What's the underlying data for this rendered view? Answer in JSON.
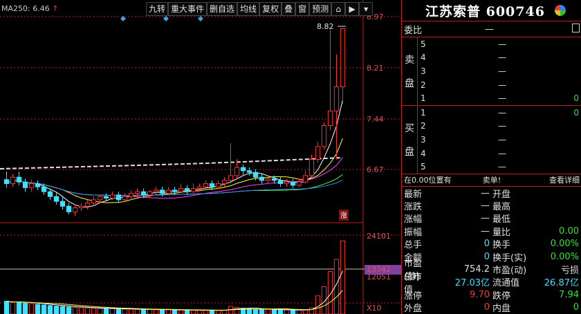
{
  "ma_label": {
    "text": "MA250: 6.46",
    "arrow": "↑"
  },
  "toolbar": [
    "九转",
    "重大事件",
    "删自选",
    "均线",
    "复权",
    "叠",
    "窗",
    "预测"
  ],
  "toolbar_icons": [
    "lock-icon",
    "forward-icon",
    "dropdown-icon"
  ],
  "price_axis": [
    "8.97",
    "8.21",
    "7.44",
    "6.67"
  ],
  "high_label": "8.82",
  "zhang_mark": "涨",
  "volume_axis": [
    "24101",
    "13342",
    "12051",
    "X10"
  ],
  "stock_title": "江苏索普 600746",
  "weibi": {
    "label": "委比",
    "value": "—",
    "right": ""
  },
  "sell": {
    "side_label": [
      "卖",
      "盘"
    ],
    "levels": [
      {
        "n": "5",
        "p": "—",
        "v": ""
      },
      {
        "n": "4",
        "p": "—",
        "v": ""
      },
      {
        "n": "3",
        "p": "—",
        "v": ""
      },
      {
        "n": "2",
        "p": "—",
        "v": ""
      },
      {
        "n": "1",
        "p": "—",
        "v": "0"
      }
    ]
  },
  "buy": {
    "side_label": [
      "买",
      "盘"
    ],
    "levels": [
      {
        "n": "1",
        "p": "—",
        "v": "0"
      },
      {
        "n": "2",
        "p": "—",
        "v": ""
      },
      {
        "n": "3",
        "p": "—",
        "v": ""
      },
      {
        "n": "4",
        "p": "—",
        "v": ""
      },
      {
        "n": "5",
        "p": "—",
        "v": ""
      }
    ]
  },
  "info_bar": {
    "left": "在0.00位置有",
    "mid": "卖单!",
    "right": "查看详细"
  },
  "quote": [
    {
      "l": "最新",
      "lv": "—",
      "r": "开盘",
      "rv": ""
    },
    {
      "l": "涨跌",
      "lv": "—",
      "r": "最高",
      "rv": ""
    },
    {
      "l": "涨幅",
      "lv": "—",
      "r": "最低",
      "rv": ""
    },
    {
      "l": "振幅",
      "lv": "—",
      "r": "量比",
      "rv": "0.00"
    },
    {
      "l": "总手",
      "lv": "0",
      "r": "换手",
      "rv": "0.00%"
    },
    {
      "l": "金额",
      "lv": "0",
      "r": "换手(实)",
      "rv": "0.00%"
    },
    {
      "l": "市盈(静)",
      "lv": "754.2",
      "r": "市盈(动)",
      "rv": "亏损"
    },
    {
      "l": "总市值",
      "lv": "27.03亿",
      "r": "流通值",
      "rv": "26.87亿"
    },
    {
      "l": "涨停",
      "lv": "9.70",
      "r": "跌停",
      "rv": "7.94"
    },
    {
      "l": "外盘",
      "lv": "0",
      "r": "内盘",
      "rv": "0"
    }
  ],
  "colors": {
    "up": "#ff3030",
    "down": "#40e0ff",
    "ma5": "#ffffff",
    "ma10": "#ffff40",
    "ma20": "#ff40ff",
    "ma60": "#40ff40",
    "ma120": "#4080ff",
    "grid": "#c02020"
  },
  "chart_data": {
    "type": "candlestick",
    "price_ylim": [
      6.45,
      8.97
    ],
    "candles": [
      [
        6.95,
        6.9,
        7.05,
        6.85
      ],
      [
        6.9,
        6.98,
        7.02,
        6.86
      ],
      [
        6.98,
        6.92,
        7.05,
        6.88
      ],
      [
        6.92,
        6.85,
        6.96,
        6.8
      ],
      [
        6.85,
        6.9,
        6.95,
        6.8
      ],
      [
        6.9,
        6.86,
        6.94,
        6.82
      ],
      [
        6.86,
        6.8,
        6.9,
        6.76
      ],
      [
        6.8,
        6.74,
        6.84,
        6.7
      ],
      [
        6.74,
        6.68,
        6.8,
        6.64
      ],
      [
        6.68,
        6.62,
        6.74,
        6.58
      ],
      [
        6.62,
        6.55,
        6.66,
        6.52
      ],
      [
        6.55,
        6.6,
        6.64,
        6.5
      ],
      [
        6.6,
        6.62,
        6.66,
        6.56
      ],
      [
        6.62,
        6.66,
        6.7,
        6.58
      ],
      [
        6.66,
        6.7,
        6.74,
        6.62
      ],
      [
        6.7,
        6.74,
        6.76,
        6.66
      ],
      [
        6.74,
        6.72,
        6.78,
        6.68
      ],
      [
        6.72,
        6.76,
        6.8,
        6.7
      ],
      [
        6.76,
        6.7,
        6.8,
        6.66
      ],
      [
        6.7,
        6.74,
        6.78,
        6.68
      ],
      [
        6.74,
        6.78,
        6.82,
        6.7
      ],
      [
        6.78,
        6.8,
        6.84,
        6.74
      ],
      [
        6.8,
        6.76,
        6.84,
        6.72
      ],
      [
        6.76,
        6.8,
        6.82,
        6.72
      ],
      [
        6.8,
        6.82,
        6.86,
        6.76
      ],
      [
        6.82,
        6.78,
        6.86,
        6.74
      ],
      [
        6.78,
        6.82,
        6.86,
        6.76
      ],
      [
        6.82,
        6.8,
        6.86,
        6.76
      ],
      [
        6.8,
        6.84,
        6.9,
        6.78
      ],
      [
        6.84,
        6.8,
        6.88,
        6.76
      ],
      [
        6.8,
        6.84,
        6.9,
        6.78
      ],
      [
        6.84,
        6.86,
        6.9,
        6.8
      ],
      [
        6.86,
        6.9,
        6.94,
        6.82
      ],
      [
        6.9,
        6.86,
        6.94,
        6.82
      ],
      [
        6.86,
        6.9,
        6.94,
        6.84
      ],
      [
        6.9,
        6.94,
        6.98,
        6.86
      ],
      [
        6.94,
        7.0,
        7.4,
        6.9
      ],
      [
        7.0,
        7.1,
        7.2,
        6.96
      ],
      [
        7.1,
        7.06,
        7.14,
        7.0
      ],
      [
        7.06,
        7.04,
        7.1,
        7.0
      ],
      [
        7.04,
        6.98,
        7.08,
        6.94
      ],
      [
        6.98,
        6.94,
        7.02,
        6.9
      ],
      [
        6.94,
        6.96,
        7.0,
        6.9
      ],
      [
        6.96,
        6.94,
        7.0,
        6.9
      ],
      [
        6.94,
        6.9,
        6.98,
        6.86
      ],
      [
        6.9,
        6.92,
        6.96,
        6.86
      ],
      [
        6.92,
        6.88,
        6.96,
        6.84
      ],
      [
        6.88,
        6.92,
        6.96,
        6.86
      ],
      [
        6.92,
        7.0,
        7.06,
        6.9
      ],
      [
        7.0,
        7.2,
        7.26,
        6.98
      ],
      [
        7.2,
        7.36,
        7.42,
        7.16
      ],
      [
        7.36,
        7.62,
        7.66,
        7.32
      ],
      [
        7.62,
        7.8,
        8.8,
        7.56
      ],
      [
        7.8,
        8.1,
        8.5,
        7.2
      ],
      [
        8.1,
        8.82,
        8.82,
        7.9
      ]
    ],
    "volume_ylim": [
      0,
      26000
    ],
    "volumes": [
      4200,
      3800,
      4000,
      3600,
      3400,
      3200,
      3000,
      2800,
      2600,
      2500,
      2300,
      2200,
      2100,
      2000,
      1900,
      1800,
      1800,
      1700,
      1700,
      1600,
      1600,
      1500,
      1500,
      1500,
      1400,
      1400,
      1400,
      1300,
      1300,
      1300,
      1300,
      1200,
      1200,
      1200,
      1200,
      1300,
      2500,
      2200,
      1900,
      1700,
      1600,
      1500,
      1500,
      1400,
      1400,
      1300,
      1300,
      1300,
      1400,
      2000,
      6000,
      9000,
      14000,
      18000,
      24101,
      22000
    ]
  }
}
